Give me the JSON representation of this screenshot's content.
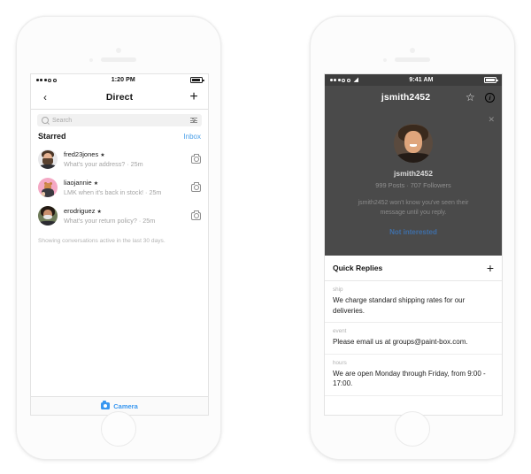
{
  "left_phone": {
    "status_bar": {
      "signal_dots_filled": 3,
      "signal_dots_empty": 2,
      "time": "1:20 PM",
      "battery_level": 90
    },
    "nav": {
      "back_icon": "chevron-left-icon",
      "title": "Direct",
      "add_icon": "plus-icon"
    },
    "search": {
      "placeholder": "Search",
      "icon": "search-icon",
      "filter_icon": "sliders-icon"
    },
    "section": {
      "title": "Starred",
      "link": "Inbox"
    },
    "conversations": [
      {
        "avatar": "av-fred",
        "name": "fred23jones",
        "starred": "★",
        "preview": "What's your address? · 25m",
        "action_icon": "camera-icon"
      },
      {
        "avatar": "av-cat",
        "name": "liaojannie",
        "starred": "★",
        "preview": "LMK when it's back in stock! · 25m",
        "action_icon": "camera-icon"
      },
      {
        "avatar": "av-ero",
        "name": "erodriguez",
        "starred": "★",
        "preview": "What's your return policy? · 25m",
        "action_icon": "camera-icon"
      }
    ],
    "footer_note": "Showing conversations active in the last 30 days.",
    "tab_bar": {
      "camera_icon": "camera-icon",
      "label": "Camera",
      "accent_color": "#3897f0"
    }
  },
  "right_phone": {
    "status_bar": {
      "signal_dots_filled": 3,
      "signal_dots_empty": 2,
      "wifi_icon": "wifi-icon",
      "time": "9:41 AM",
      "battery_level": 100
    },
    "nav": {
      "title": "jsmith2452",
      "star_icon": "star-outline-icon",
      "info_icon": "info-circle-icon"
    },
    "overlay": {
      "close_icon": "close-icon",
      "avatar": "av-js",
      "username": "jsmith2452",
      "stats": "999 Posts  ·  707 Followers",
      "message": "jsmith2452 won't know you've seen their message until you reply.",
      "action_label": "Not interested",
      "action_color": "#3f6fa8",
      "background_color": "#4a4a4a"
    },
    "quick_replies": {
      "title": "Quick Replies",
      "add_icon": "plus-icon",
      "items": [
        {
          "tag": "ship",
          "text": "We charge standard shipping rates for our deliveries."
        },
        {
          "tag": "event",
          "text": "Please email us at groups@paint-box.com."
        },
        {
          "tag": "hours",
          "text": "We are open Monday through Friday, from 9:00 - 17:00."
        }
      ]
    }
  }
}
